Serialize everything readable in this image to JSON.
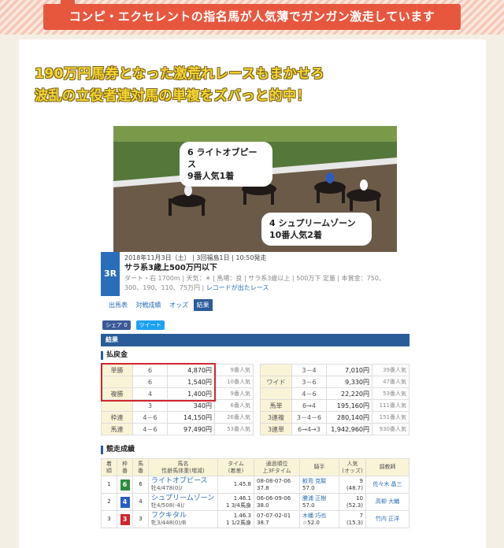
{
  "banner": {
    "text": "コンピ・エクセレントの指名馬が人気薄でガンガン激走しています"
  },
  "headline": {
    "line1": "190万円馬券となった激荒れレースもまかせろ",
    "line2": "波乱の立役者連対馬の単複をズバっと的中！"
  },
  "photo": {
    "bubble1_line1": "6 ライトオブピース",
    "bubble1_line2": "9番人気1着",
    "bubble2_line1": "4 シュプリームゾーン",
    "bubble2_line2": "10番人気2着"
  },
  "race": {
    "number": "3R",
    "date_line": "2018年11月3日（土） | 3回福島1日 | 10:50発走",
    "title": "サラ系3歳上500万円以下",
    "info_line1": "ダート・右 1700m | 天気：☀ | 馬場：良 | サラ系3歳以上 | 500万下 定量 | 本賞金：750、",
    "info_line2": "300、190、110、75万円 |",
    "record_link": "レコードが出たレース"
  },
  "tabs": [
    "出馬表",
    "対戦成績",
    "オッズ",
    "結果"
  ],
  "social": {
    "fb": "シェア 0",
    "tw": "ツイート"
  },
  "result_bar": "結果",
  "payout_head": "払戻金",
  "payout_left": [
    {
      "label": "単勝",
      "num": "6",
      "amt": "4,870円",
      "pop": "9番人気"
    },
    {
      "label": "",
      "num": "6",
      "amt": "1,540円",
      "pop": "10番人気"
    },
    {
      "label": "複勝",
      "num": "4",
      "amt": "1,400円",
      "pop": "9番人気"
    },
    {
      "label": "",
      "num": "3",
      "amt": "340円",
      "pop": "6番人気"
    },
    {
      "label": "枠連",
      "num": "4－6",
      "amt": "14,150円",
      "pop": "26番人気"
    },
    {
      "label": "馬連",
      "num": "4－6",
      "amt": "97,490円",
      "pop": "53番人気"
    }
  ],
  "payout_right": [
    {
      "label": "",
      "num": "3－4",
      "amt": "7,010円",
      "pop": "39番人気"
    },
    {
      "label": "ワイド",
      "num": "3－6",
      "amt": "9,330円",
      "pop": "47番人気"
    },
    {
      "label": "",
      "num": "4－6",
      "amt": "22,220円",
      "pop": "53番人気"
    },
    {
      "label": "馬単",
      "num": "6→4",
      "amt": "195,160円",
      "pop": "111番人気"
    },
    {
      "label": "3連複",
      "num": "3－4－6",
      "amt": "280,140円",
      "pop": "151番人気"
    },
    {
      "label": "3連単",
      "num": "6→4→3",
      "amt": "1,942,960円",
      "pop": "930番人気"
    }
  ],
  "race_result_head": "競走成績",
  "result_headers": [
    "着順",
    "枠番",
    "馬番",
    "馬名\n性齢馬体重(増減)",
    "タイム\n(着差)",
    "通過順位\n上3Fタイム",
    "騎手",
    "人気\n(オッズ)",
    "調教師"
  ],
  "results": [
    {
      "rank": "1",
      "waku": "6",
      "waku_color": "#2e8b3e",
      "umaban": "6",
      "name": "ライトオブピース",
      "sub": "牡4/478(0)/",
      "time": "1.45.8",
      "margin": "",
      "pass": "08-08-07-06",
      "f3": "37.8",
      "jockey": "鮫島 克駿",
      "weight": "57.0",
      "pop": "9",
      "odds": "(48.7)",
      "trainer": "佐々木 晶三"
    },
    {
      "rank": "2",
      "waku": "4",
      "waku_color": "#2a5cc4",
      "umaban": "4",
      "name": "シュプリームゾーン",
      "sub": "牡4/508(-4)/",
      "time": "1.46.1",
      "margin": "1 3/4馬身",
      "pass": "06-06-09-06",
      "f3": "38.0",
      "jockey": "勝浦 正樹",
      "weight": "57.0",
      "pop": "10",
      "odds": "(52.3)",
      "trainer": "高柳 大輔"
    },
    {
      "rank": "3",
      "waku": "3",
      "waku_color": "#d0262e",
      "umaban": "3",
      "name": "フクキタル",
      "sub": "牝3/448(0)/B",
      "time": "1.46.3",
      "margin": "1 1/2馬身",
      "pass": "07-07-02-01",
      "f3": "38.7",
      "jockey": "木幡 巧也",
      "weight": "☆52.0",
      "pop": "7",
      "odds": "(15.3)",
      "trainer": "竹内 正洋"
    }
  ]
}
